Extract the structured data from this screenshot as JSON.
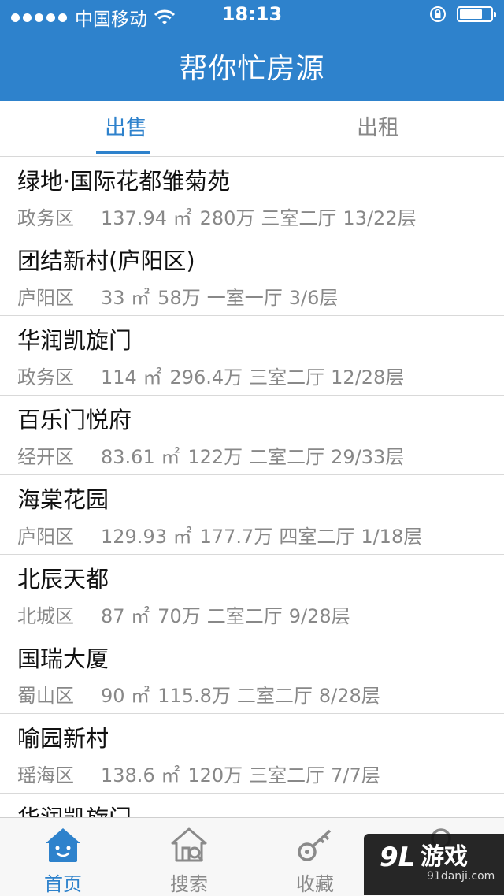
{
  "status_bar": {
    "carrier": "中国移动",
    "time": "18:13"
  },
  "header": {
    "title": "帮你忙房源"
  },
  "tabs": [
    {
      "label": "出售",
      "active": true
    },
    {
      "label": "出租",
      "active": false
    }
  ],
  "listings": [
    {
      "name": "绿地·国际花都雏菊苑",
      "district": "政务区",
      "area": "137.94 ㎡",
      "price": "280万",
      "layout": "三室二厅",
      "floor": "13/22层"
    },
    {
      "name": "团结新村(庐阳区)",
      "district": "庐阳区",
      "area": "33 ㎡",
      "price": "58万",
      "layout": "一室一厅",
      "floor": "3/6层"
    },
    {
      "name": "华润凯旋门",
      "district": "政务区",
      "area": "114 ㎡",
      "price": "296.4万",
      "layout": "三室二厅",
      "floor": "12/28层"
    },
    {
      "name": "百乐门悦府",
      "district": "经开区",
      "area": "83.61 ㎡",
      "price": "122万",
      "layout": "二室二厅",
      "floor": "29/33层"
    },
    {
      "name": "海棠花园",
      "district": "庐阳区",
      "area": "129.93 ㎡",
      "price": "177.7万",
      "layout": "四室二厅",
      "floor": "1/18层"
    },
    {
      "name": "北辰天都",
      "district": "北城区",
      "area": "87 ㎡",
      "price": "70万",
      "layout": "二室二厅",
      "floor": "9/28层"
    },
    {
      "name": "国瑞大厦",
      "district": "蜀山区",
      "area": "90 ㎡",
      "price": "115.8万",
      "layout": "二室二厅",
      "floor": "8/28层"
    },
    {
      "name": "喻园新村",
      "district": "瑶海区",
      "area": "138.6 ㎡",
      "price": "120万",
      "layout": "三室二厅",
      "floor": "7/7层"
    },
    {
      "name": "华润凯旋门",
      "district": "",
      "area": "",
      "price": "",
      "layout": "",
      "floor": ""
    }
  ],
  "tabbar": [
    {
      "label": "首页",
      "icon": "home-icon",
      "active": true
    },
    {
      "label": "搜索",
      "icon": "house-search-icon",
      "active": false
    },
    {
      "label": "收藏",
      "icon": "key-icon",
      "active": false
    },
    {
      "label": "",
      "icon": "user-icon",
      "active": false
    }
  ],
  "watermark": {
    "brand": "游戏",
    "logo": "9L",
    "site": "91danji.com"
  },
  "colors": {
    "accent": "#2e82cc",
    "muted": "#888888"
  }
}
